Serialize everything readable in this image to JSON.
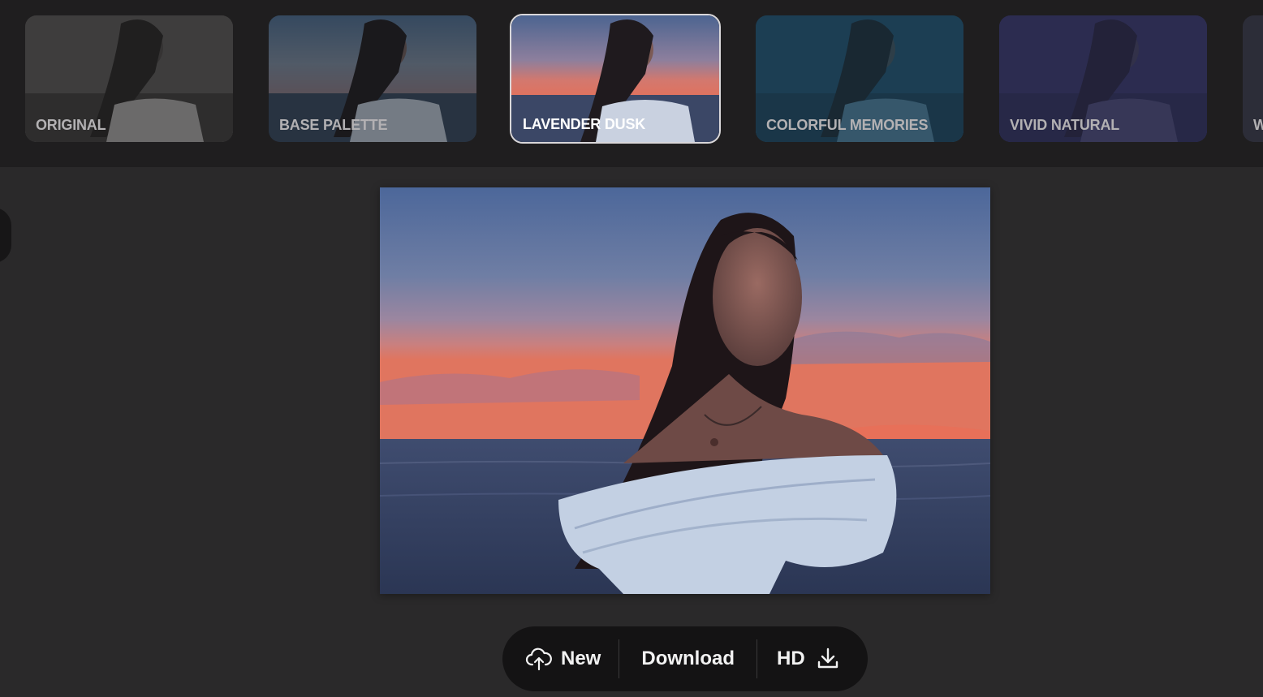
{
  "filters": [
    {
      "label": "ORIGINAL",
      "selected": false
    },
    {
      "label": "BASE PALETTE",
      "selected": false
    },
    {
      "label": "LAVENDER DUSK",
      "selected": true
    },
    {
      "label": "COLORFUL MEMORIES",
      "selected": false
    },
    {
      "label": "VIVID NATURAL",
      "selected": false
    },
    {
      "label": "W",
      "selected": false
    }
  ],
  "toolbar": {
    "new_label": "New",
    "download_label": "Download",
    "hd_label": "HD"
  },
  "icons": {
    "new": "cloud-upload-icon",
    "hd": "download-icon"
  },
  "colors": {
    "background": "#2a292a",
    "filter_bar": "#1f1e1f",
    "toolbar": "#141314",
    "selected_border": "#d9d7d9"
  }
}
